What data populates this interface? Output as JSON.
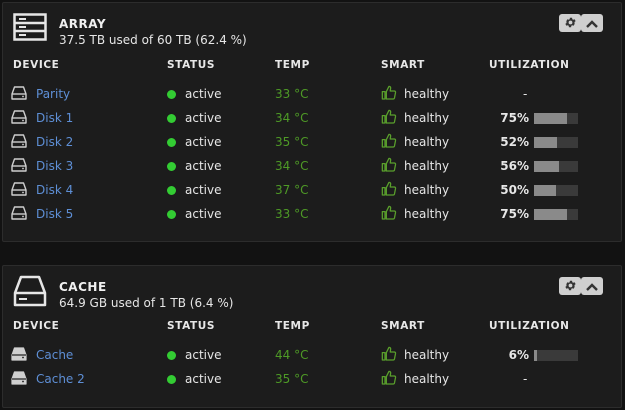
{
  "columns": {
    "device": "DEVICE",
    "status": "STATUS",
    "temp": "TEMP",
    "smart": "SMART",
    "utilization": "UTILIZATION"
  },
  "array": {
    "title": "ARRAY",
    "subtitle": "37.5 TB used of 60 TB (62.4 %)",
    "rows": [
      {
        "name": "Parity",
        "status": "active",
        "temp": "33 °C",
        "smart": "healthy",
        "util_label": "-",
        "util": null
      },
      {
        "name": "Disk 1",
        "status": "active",
        "temp": "34 °C",
        "smart": "healthy",
        "util_label": "75%",
        "util": 75
      },
      {
        "name": "Disk 2",
        "status": "active",
        "temp": "35 °C",
        "smart": "healthy",
        "util_label": "52%",
        "util": 52
      },
      {
        "name": "Disk 3",
        "status": "active",
        "temp": "34 °C",
        "smart": "healthy",
        "util_label": "56%",
        "util": 56
      },
      {
        "name": "Disk 4",
        "status": "active",
        "temp": "37 °C",
        "smart": "healthy",
        "util_label": "50%",
        "util": 50
      },
      {
        "name": "Disk 5",
        "status": "active",
        "temp": "33 °C",
        "smart": "healthy",
        "util_label": "75%",
        "util": 75
      }
    ]
  },
  "cache": {
    "title": "CACHE",
    "subtitle": "64.9 GB used of 1 TB (6.4 %)",
    "rows": [
      {
        "name": "Cache",
        "status": "active",
        "temp": "44 °C",
        "smart": "healthy",
        "util_label": "6%",
        "util": 6
      },
      {
        "name": "Cache 2",
        "status": "active",
        "temp": "35 °C",
        "smart": "healthy",
        "util_label": "-",
        "util": null
      }
    ]
  },
  "colors": {
    "accent_link": "#5e8fd6",
    "status_active": "#33cc33",
    "temp": "#4e9a26",
    "smart_icon": "#5aa02c",
    "bar_fill": "#8a8a8a",
    "bar_track": "#3a3a3a"
  },
  "icons": {
    "array": "server-rack-icon",
    "cache": "drive-icon",
    "hdd": "hdd-icon",
    "ssd": "ssd-icon",
    "smart": "thumbs-up-icon",
    "settings": "gear-icon",
    "collapse": "chevron-up-icon"
  }
}
